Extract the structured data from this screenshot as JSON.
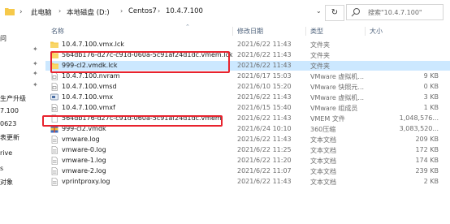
{
  "address_bar": {
    "breadcrumbs": [
      "此电脑",
      "本地磁盘 (D:)",
      "Centos7",
      "10.4.7.100"
    ],
    "search_placeholder": "搜索\"10.4.7.100\""
  },
  "left_pane": {
    "items": [
      "问",
      "生产升级",
      "7.100",
      "0623",
      "表更新",
      "rive",
      "s",
      "对象"
    ]
  },
  "columns": {
    "name": "名称",
    "date": "修改日期",
    "type": "类型",
    "size": "大小"
  },
  "files": [
    {
      "name": "10.4.7.100.vmx.lck",
      "date": "2021/6/22 11:43",
      "type": "文件夹",
      "size": "",
      "icon": "folder-icon"
    },
    {
      "name": "564db176-d27c-c91d-060a-5c91af24d1dc.vmem.lck",
      "date": "2021/6/22 11:43",
      "type": "文件夹",
      "size": "",
      "icon": "folder-icon"
    },
    {
      "name": "999-cl2.vmdk.lck",
      "date": "2021/6/22 11:43",
      "type": "文件夹",
      "size": "",
      "icon": "folder-icon"
    },
    {
      "name": "10.4.7.100.nvram",
      "date": "2021/6/17 15:03",
      "type": "VMware 虚拟机...",
      "size": "9 KB",
      "icon": "vmware-file-icon"
    },
    {
      "name": "10.4.7.100.vmsd",
      "date": "2021/6/10 15:20",
      "type": "VMware 快照元...",
      "size": "0 KB",
      "icon": "vmware-file-icon"
    },
    {
      "name": "10.4.7.100.vmx",
      "date": "2021/6/22 11:43",
      "type": "VMware 虚拟机...",
      "size": "3 KB",
      "icon": "vmware-vm-icon"
    },
    {
      "name": "10.4.7.100.vmxf",
      "date": "2021/6/15 15:40",
      "type": "VMware 组成员",
      "size": "1 KB",
      "icon": "vmware-file-icon"
    },
    {
      "name": "564db176-d27c-c91d-060a-5c91af24d1dc.vmem",
      "date": "2021/6/22 11:43",
      "type": "VMEM 文件",
      "size": "1,048,576...",
      "icon": "blank-file-icon"
    },
    {
      "name": "999-cl2.vmdk",
      "date": "2021/6/24 10:10",
      "type": "360压缩",
      "size": "3,083,520...",
      "icon": "archive-icon"
    },
    {
      "name": "vmware.log",
      "date": "2021/6/22 11:43",
      "type": "文本文档",
      "size": "209 KB",
      "icon": "text-file-icon"
    },
    {
      "name": "vmware-0.log",
      "date": "2021/6/22 11:25",
      "type": "文本文档",
      "size": "172 KB",
      "icon": "text-file-icon"
    },
    {
      "name": "vmware-1.log",
      "date": "2021/6/22 11:20",
      "type": "文本文档",
      "size": "174 KB",
      "icon": "text-file-icon"
    },
    {
      "name": "vmware-2.log",
      "date": "2021/6/22 11:07",
      "type": "文本文档",
      "size": "239 KB",
      "icon": "text-file-icon"
    },
    {
      "name": "vprintproxy.log",
      "date": "2021/6/22 11:43",
      "type": "文本文档",
      "size": "2 KB",
      "icon": "text-file-icon"
    }
  ],
  "selected_index": 2,
  "colors": {
    "selection": "#cce8ff",
    "highlight": "#e8232e",
    "folder": "#f6c94a"
  }
}
